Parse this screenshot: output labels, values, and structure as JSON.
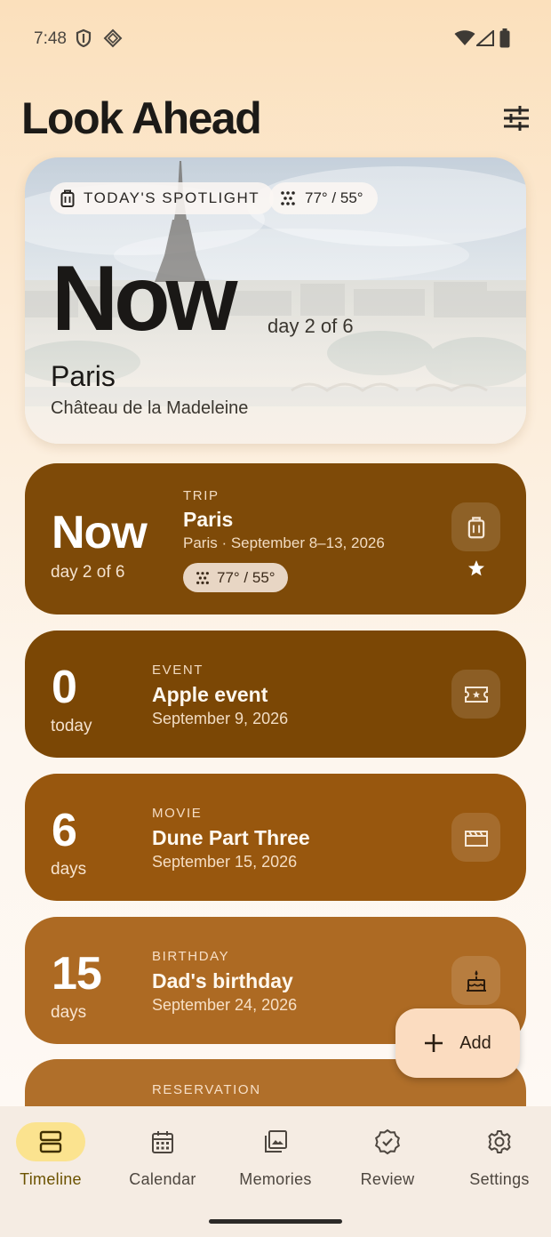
{
  "status": {
    "time": "7:48"
  },
  "app": {
    "title": "Look Ahead"
  },
  "spotlight": {
    "badge": "TODAY'S SPOTLIGHT",
    "weather": "77° / 55°",
    "headline": "Now",
    "day": "day 2 of 6",
    "city": "Paris",
    "place": "Château de la Madeleine"
  },
  "cards": [
    {
      "count": "Now",
      "unit": "day 2 of 6",
      "category": "TRIP",
      "title": "Paris",
      "date": "Paris · September 8–13, 2026",
      "weather": "77° / 55°",
      "icon": "luggage-icon",
      "color": "#7e4a08"
    },
    {
      "count": "0",
      "unit": "today",
      "category": "EVENT",
      "title": "Apple event",
      "date": "September 9, 2026",
      "icon": "ticket-icon",
      "color": "#7b4705"
    },
    {
      "count": "6",
      "unit": "days",
      "category": "MOVIE",
      "title": "Dune Part Three",
      "date": "September 15, 2026",
      "icon": "movie-icon",
      "color": "#98570e"
    },
    {
      "count": "15",
      "unit": "days",
      "category": "BIRTHDAY",
      "title": "Dad's birthday",
      "date": "September 24, 2026",
      "icon": "cake-icon",
      "color": "#ad6a23"
    },
    {
      "category": "RESERVATION",
      "color": "#b06f2a"
    }
  ],
  "fab": {
    "label": "Add"
  },
  "nav": [
    {
      "label": "Timeline",
      "icon": "timeline-icon",
      "active": true
    },
    {
      "label": "Calendar",
      "icon": "calendar-icon"
    },
    {
      "label": "Memories",
      "icon": "memories-icon"
    },
    {
      "label": "Review",
      "icon": "review-icon"
    },
    {
      "label": "Settings",
      "icon": "settings-icon"
    }
  ]
}
